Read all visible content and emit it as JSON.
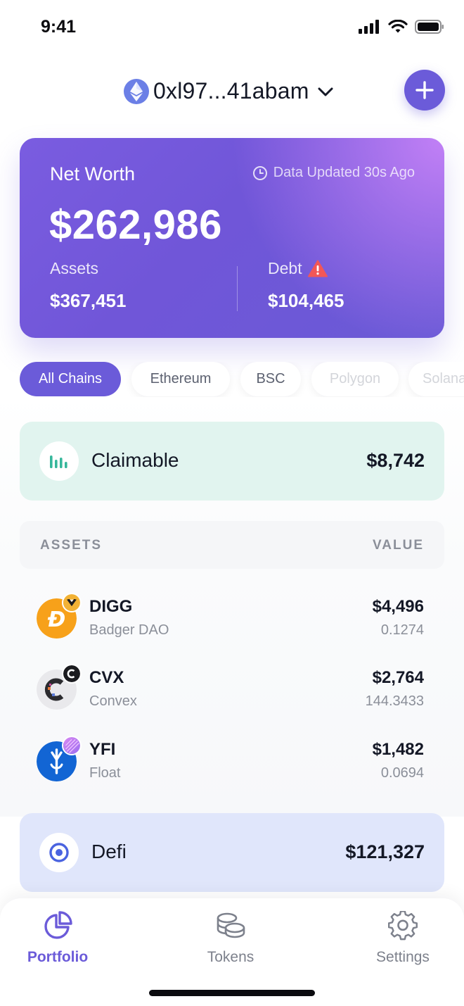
{
  "status_bar": {
    "time": "9:41"
  },
  "header": {
    "wallet_address": "0xl97...41abam",
    "network_icon": "ethereum-icon",
    "add_icon": "plus-icon"
  },
  "networth": {
    "label": "Net Worth",
    "updated": "Data Updated 30s Ago",
    "value": "$262,986",
    "assets_label": "Assets",
    "assets_value": "$367,451",
    "debt_label": "Debt",
    "debt_value": "$104,465"
  },
  "chains": [
    "All Chains",
    "Ethereum",
    "BSC",
    "Polygon",
    "Solana"
  ],
  "claimable": {
    "title": "Claimable",
    "amount": "$8,742"
  },
  "assets_table": {
    "col_assets": "ASSETS",
    "col_value": "VALUE",
    "rows": [
      {
        "symbol": "DIGG",
        "protocol": "Badger DAO",
        "value": "$4,496",
        "amount": "0.1274"
      },
      {
        "symbol": "CVX",
        "protocol": "Convex",
        "value": "$2,764",
        "amount": "144.3433"
      },
      {
        "symbol": "YFI",
        "protocol": "Float",
        "value": "$1,482",
        "amount": "0.0694"
      }
    ]
  },
  "defi": {
    "title": "Defi",
    "amount": "$121,327"
  },
  "tabs": [
    {
      "label": "Portfolio",
      "icon": "pie-chart-icon"
    },
    {
      "label": "Tokens",
      "icon": "coins-icon"
    },
    {
      "label": "Settings",
      "icon": "gear-icon"
    }
  ],
  "colors": {
    "accent": "#6b5bd9",
    "claimable_bg": "#e1f4ef",
    "defi_bg": "#e0e6fb",
    "danger": "#f25757"
  }
}
